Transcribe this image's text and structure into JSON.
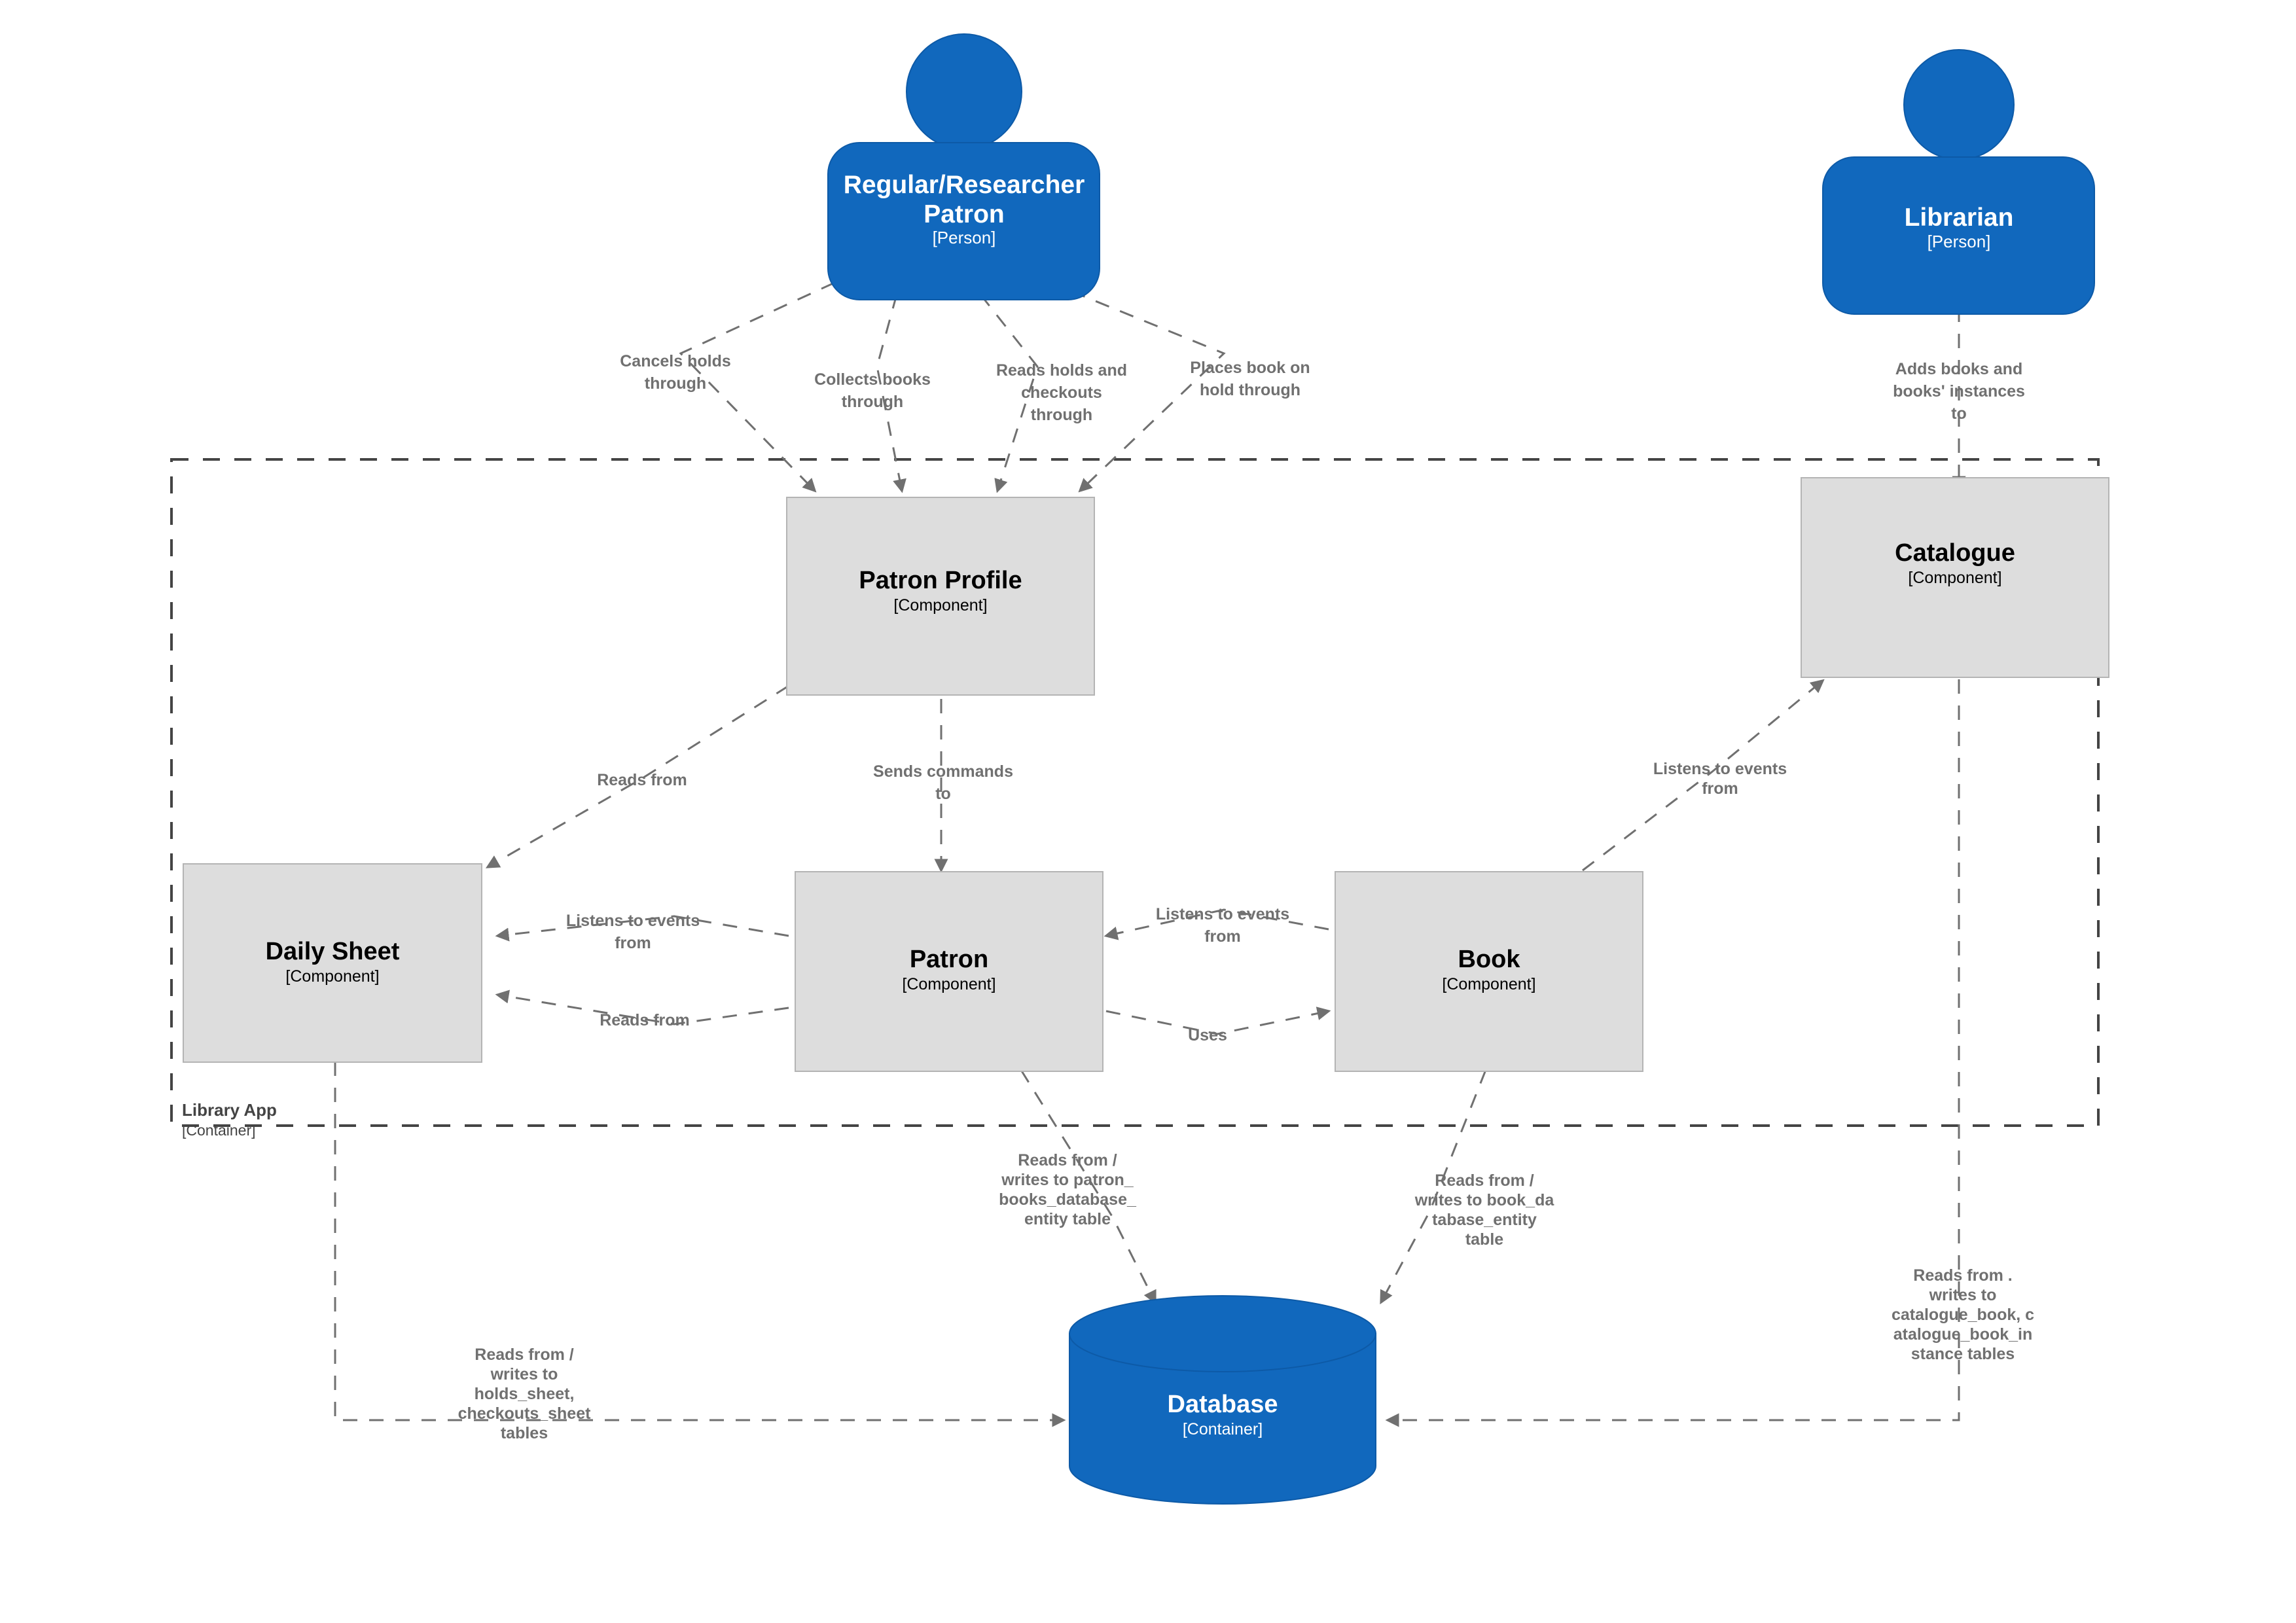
{
  "diagram": {
    "type": "C4 Component Diagram",
    "boundary": {
      "name": "Library App",
      "tag": "[Container]"
    },
    "people": [
      {
        "id": "patron",
        "name": "Regular/Researcher Patron",
        "name_line1": "Regular/Researcher",
        "name_line2": "Patron",
        "tag": "[Person]",
        "color": "#1168bd"
      },
      {
        "id": "librarian",
        "name": "Librarian",
        "name_line1": "Librarian",
        "tag": "[Person]",
        "color": "#1168bd"
      }
    ],
    "components": [
      {
        "id": "patron_profile",
        "name": "Patron Profile",
        "tag": "[Component]",
        "color": "#dddddd"
      },
      {
        "id": "catalogue",
        "name": "Catalogue",
        "tag": "[Component]",
        "color": "#dddddd"
      },
      {
        "id": "daily_sheet",
        "name": "Daily Sheet",
        "tag": "[Component]",
        "color": "#dddddd"
      },
      {
        "id": "patron_comp",
        "name": "Patron",
        "tag": "[Component]",
        "color": "#dddddd"
      },
      {
        "id": "book",
        "name": "Book",
        "tag": "[Component]",
        "color": "#dddddd"
      }
    ],
    "containers": [
      {
        "id": "database",
        "name": "Database",
        "tag": "[Container]",
        "color": "#1168bd",
        "shape": "cylinder"
      }
    ],
    "relationships": [
      {
        "id": "r1",
        "from": "patron",
        "to": "patron_profile",
        "label_lines": [
          "Cancels holds",
          "through"
        ]
      },
      {
        "id": "r2",
        "from": "patron",
        "to": "patron_profile",
        "label_lines": [
          "Collects books",
          "through"
        ]
      },
      {
        "id": "r3",
        "from": "patron",
        "to": "patron_profile",
        "label_lines": [
          "Reads holds and",
          "checkouts",
          "through"
        ]
      },
      {
        "id": "r4",
        "from": "patron",
        "to": "patron_profile",
        "label_lines": [
          "Places book on",
          "hold through"
        ]
      },
      {
        "id": "r5",
        "from": "librarian",
        "to": "catalogue",
        "label_lines": [
          "Adds books and",
          "books' instances",
          "to"
        ]
      },
      {
        "id": "r6",
        "from": "patron_profile",
        "to": "daily_sheet",
        "label_lines": [
          "Reads from"
        ]
      },
      {
        "id": "r7",
        "from": "patron_profile",
        "to": "patron_comp",
        "label_lines": [
          "Sends commands",
          "to"
        ]
      },
      {
        "id": "r8",
        "from": "daily_sheet",
        "to": "patron_comp",
        "label_lines": [
          "Listens to events",
          "from"
        ]
      },
      {
        "id": "r9",
        "from": "patron_comp",
        "to": "daily_sheet",
        "label_lines": [
          "Reads from"
        ]
      },
      {
        "id": "r10",
        "from": "book",
        "to": "patron_comp",
        "label_lines": [
          "Listens to events",
          "from"
        ]
      },
      {
        "id": "r11",
        "from": "patron_comp",
        "to": "book",
        "label_lines": [
          "Uses"
        ]
      },
      {
        "id": "r12",
        "from": "book",
        "to": "catalogue",
        "label_lines": [
          "Listens to events",
          "from"
        ]
      },
      {
        "id": "r13",
        "from": "patron_comp",
        "to": "database",
        "label_lines": [
          "Reads from /",
          "writes to patron_",
          "books_database_",
          "entity table"
        ]
      },
      {
        "id": "r14",
        "from": "book",
        "to": "database",
        "label_lines": [
          "Reads from /",
          "writes to book_da",
          "tabase_entity",
          "table"
        ]
      },
      {
        "id": "r15",
        "from": "catalogue",
        "to": "database",
        "label_lines": [
          "Reads from .",
          "writes to",
          "catalogue_book, c",
          "atalogue_book_in",
          "stance tables"
        ]
      },
      {
        "id": "r16",
        "from": "daily_sheet",
        "to": "database",
        "label_lines": [
          "Reads from /",
          "writes to",
          "holds_sheet,",
          "checkouts_sheet",
          "tables"
        ]
      }
    ]
  }
}
